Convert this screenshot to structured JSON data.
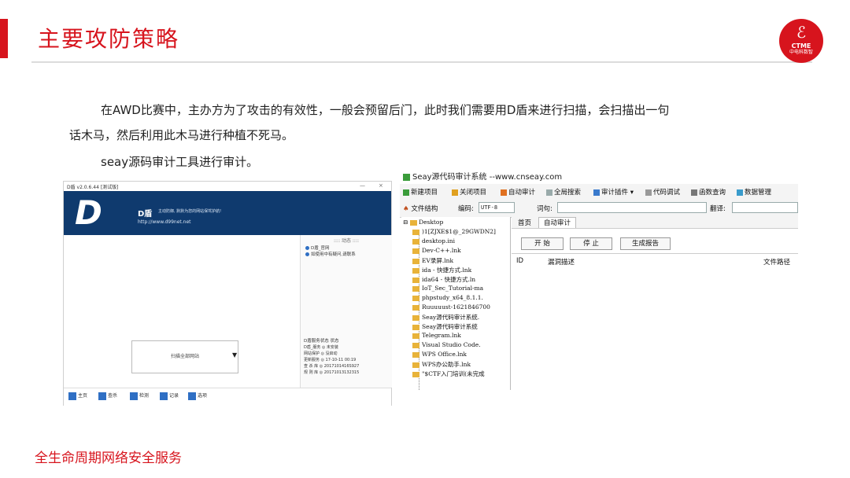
{
  "slide": {
    "title": "主要攻防策略",
    "logo_brand": "CTME",
    "logo_sub": "中电科数智",
    "paragraph1": "在AWD比赛中，主办方为了攻击的有效性，一般会预留后门，此时我们需要用D盾来进行扫描，会扫描出一句",
    "paragraph2": "话木马，然后利用此木马进行种植不死马。",
    "paragraph3": "seay源码审计工具进行审计。",
    "footer": "全生命周期网络安全服务"
  },
  "colors": {
    "brand_red": "#d7141d",
    "dshield_blue": "#0f3a6e"
  },
  "dshield": {
    "window_title": "D盾 v2.0.6.44 [测试版]",
    "minimize": "—",
    "close": "×",
    "logo_text": "D",
    "name": "D盾",
    "slogan": "主动防御, 默默为您的网站保驾护航!",
    "url": "http://www.d99net.net",
    "scan_button": "扫描全部网站",
    "dropdown_arrow": "▼",
    "side_header": ":::: 动态 ::::",
    "side_items": [
      "D盾_官网",
      "如使用中有疑问,请联系"
    ],
    "status_header": "D盾服务状态    状态",
    "status_rows": [
      "D盾_服务    ◎  未安装",
      "网站保护    ◎  没启动",
      "更新服务    ◎  17-10-11 00:19",
      "查 杀 库    ◎  2017101416S927",
      "规 则 库    ◎  20171013132315"
    ],
    "nav": [
      "主页",
      "查杀",
      "检测",
      "记录",
      "选项"
    ]
  },
  "seay": {
    "window_title": "Seay源代码审计系统 --www.cnseay.com",
    "toolbar": [
      "新建项目",
      "关闭项目",
      "自动审计",
      "全局搜索",
      "审计插件 ▾",
      "代码调试",
      "函数查询",
      "数据管理"
    ],
    "file_structure": "文件结构",
    "encoding_label": "编码:",
    "encoding_value": "UTF-8",
    "word_label": "词句:",
    "translate_label": "翻译:",
    "tree_root": "Desktop",
    "tree_items": [
      ")1[ZJXE$1@_29GWDN2]",
      "desktop.ini",
      "Dev-C++.lnk",
      "EV录屏.lnk",
      "ida - 快捷方式.lnk",
      "ida64 - 快捷方式.ln",
      "IoT_Sec_Tutorial-ma",
      "phpstudy_x64_8.1.1.",
      "Ruuuuust-1621846700",
      "Seay源代码审计系统.",
      "Seay源代码审计系统",
      "Telegram.lnk",
      "Visual Studio Code.",
      "WPS Office.lnk",
      "WPS办公助手.lnk",
      "\"$CTF入门培训(未完成"
    ],
    "tabs": [
      "首页",
      "自动审计"
    ],
    "buttons": [
      "开 始",
      "停 止",
      "生成报告"
    ],
    "grid_headers": [
      "ID",
      "漏洞描述",
      "文件路径"
    ]
  }
}
